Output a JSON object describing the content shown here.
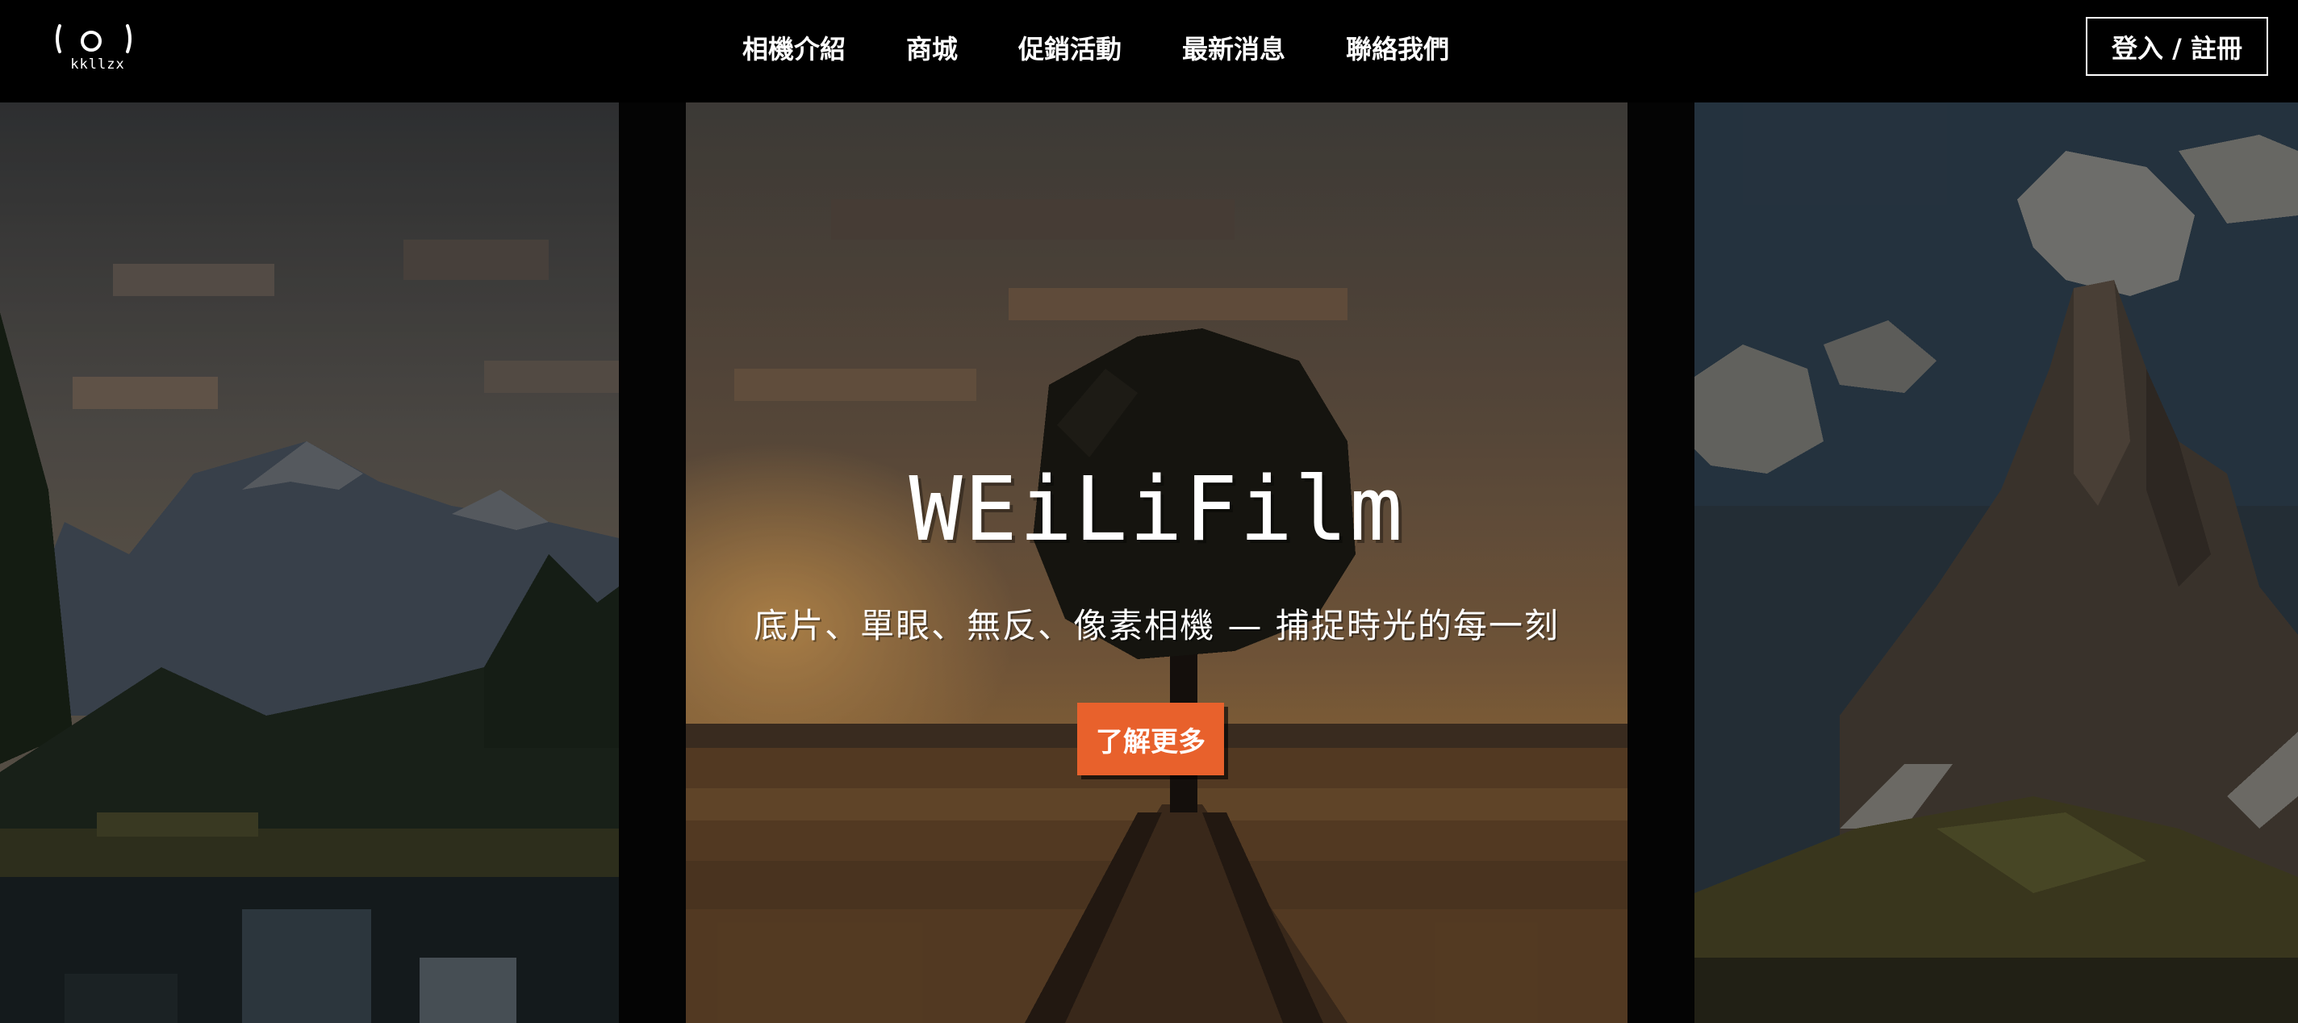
{
  "brand": {
    "logo_text": "kkllzx"
  },
  "nav": {
    "items": [
      {
        "label": "相機介紹"
      },
      {
        "label": "商城"
      },
      {
        "label": "促銷活動"
      },
      {
        "label": "最新消息"
      },
      {
        "label": "聯絡我們"
      }
    ]
  },
  "header": {
    "login_label": "登入 / 註冊"
  },
  "hero": {
    "title": "WEiLiFilm",
    "subtitle": "底片、單眼、無反、像素相機 — 捕捉時光的每一刻",
    "cta_label": "了解更多"
  },
  "colors": {
    "header_bg": "#000000",
    "accent": "#e8612c",
    "text": "#ffffff"
  },
  "images": {
    "left_panel": "pixel-art mountain lake landscape",
    "center_panel": "pixel-art sunset tree and road",
    "right_panel": "pixel-art rocky mountain peak under sky"
  }
}
